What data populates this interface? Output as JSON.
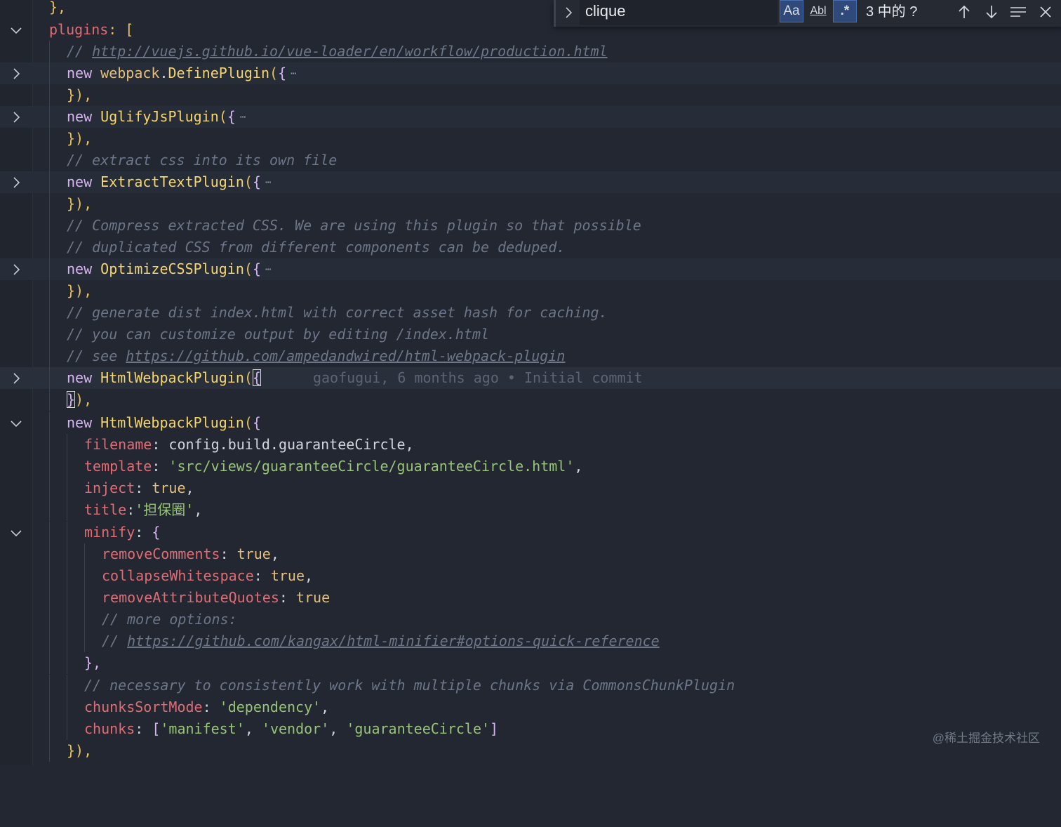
{
  "find": {
    "query": "clique",
    "match_case_label": "Aa",
    "whole_word_label": "Abl",
    "regex_label": ".*",
    "result_count": "3 中的 ?"
  },
  "code": {
    "l0": "},",
    "l1_key": "plugins",
    "l1_rest": ": [",
    "l2_comment": "// ",
    "l2_url": "http://vuejs.github.io/vue-loader/en/workflow/production.html",
    "new_kw": "new",
    "l3_obj": "webpack",
    "l3_fn": "DefinePlugin",
    "open_paren": "(",
    "open_brace": "{",
    "ellipsis": "⋯",
    "close": "}),",
    "l5_fn": "UglifyJsPlugin",
    "l7_comment": "// extract css into its own file",
    "l8_fn": "ExtractTextPlugin",
    "l10_comment": "// Compress extracted CSS. We are using this plugin so that possible",
    "l11_comment": "// duplicated CSS from different components can be deduped.",
    "l12_fn": "OptimizeCSSPlugin",
    "l14_comment": "// generate dist index.html with correct asset hash for caching.",
    "l15_comment": "// you can customize output by editing /index.html",
    "l16_comment": "// see ",
    "l16_url": "https://github.com/ampedandwired/html-webpack-plugin",
    "l17_fn": "HtmlWebpackPlugin",
    "blame": "gaofugui, 6 months ago • Initial commit",
    "l18_brace": "}",
    "l18_rest": "),",
    "l19_fn": "HtmlWebpackPlugin",
    "l20_key": "filename",
    "l20_val": "config.build.guaranteeCircle",
    "l21_key": "template",
    "l21_val": "'src/views/guaranteeCircle/guaranteeCircle.html'",
    "l22_key": "inject",
    "l22_val": "true",
    "l23_key": "title",
    "l23_val": "'担保圈'",
    "l24_key": "minify",
    "l25_key": "removeComments",
    "l25_val": "true",
    "l26_key": "collapseWhitespace",
    "l26_val": "true",
    "l27_key": "removeAttributeQuotes",
    "l27_val": "true",
    "l28_comment": "// more options:",
    "l29_comment": "// ",
    "l29_url": "https://github.com/kangax/html-minifier#options-quick-reference",
    "l30": "},",
    "l31_comment": "// necessary to consistently work with multiple chunks via CommonsChunkPlugin",
    "l32_key": "chunksSortMode",
    "l32_val": "'dependency'",
    "l33_key": "chunks",
    "l33_v1": "'manifest'",
    "l33_v2": "'vendor'",
    "l33_v3": "'guaranteeCircle'",
    "l34": "}),"
  },
  "watermark": "@稀土掘金技术社区",
  "colors": {
    "background": "#222731",
    "keyword": "#d6b4f0",
    "property": "#e06c75",
    "string": "#98c379",
    "comment": "#6d7688",
    "function": "#f5d56e"
  }
}
